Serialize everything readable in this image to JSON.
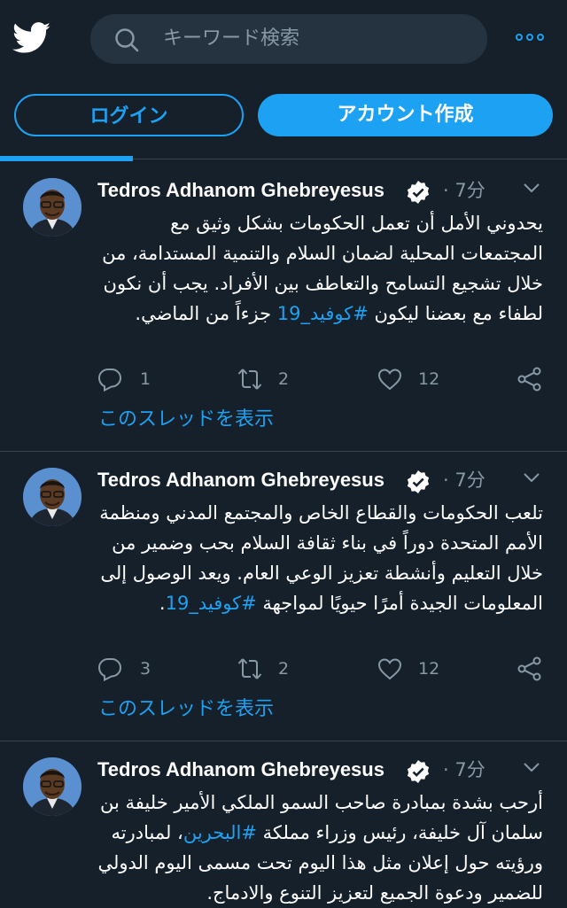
{
  "header": {
    "search_placeholder": "キーワード検索",
    "accent_color": "#1da1f2",
    "background_color": "#15202b"
  },
  "auth": {
    "login_label": "ログイン",
    "signup_label": "アカウント作成"
  },
  "tweets": [
    {
      "author": "Tedros Adhanom Ghebreyesus",
      "time": "· 7分",
      "text_before": "يحدوني الأمل أن تعمل الحكومات بشكل وثيق مع المجتمعات المحلية لضمان السلام والتنمية المستدامة، من خلال تشجيع التسامح والتعاطف بين الأفراد. يجب أن نكون لطفاء مع بعضنا ليكون ",
      "hashtag": "#كوفيد_19",
      "text_after": " جزءاً من الماضي.",
      "replies": "1",
      "retweets": "2",
      "likes": "12",
      "thread_link": "このスレッドを表示"
    },
    {
      "author": "Tedros Adhanom Ghebreyesus",
      "time": "· 7分",
      "text_before": "تلعب الحكومات والقطاع الخاص والمجتمع المدني ومنظمة الأمم المتحدة دوراً في بناء ثقافة السلام بحب وضمير  من خلال التعليم وأنشطة تعزيز الوعي العام. ويعد الوصول إلى المعلومات الجيدة أمرًا حيويًا لمواجهة ",
      "hashtag": "#كوفيد_19",
      "text_after": ".",
      "replies": "3",
      "retweets": "2",
      "likes": "12",
      "thread_link": "このスレッドを表示"
    },
    {
      "author": "Tedros Adhanom Ghebreyesus",
      "time": "· 7分",
      "text_before": "أرحب بشدة بمبادرة صاحب السمو الملكي الأمير خليفة بن سلمان آل خليفة، رئيس وزراء مملكة ",
      "hashtag": "#البحرين",
      "text_after": "، لمبادرته ورؤيته حول إعلان مثل هذا اليوم تحت مسمى اليوم الدولي للضمير ودعوة الجميع لتعزيز التنوع والادماج."
    }
  ],
  "icons": {
    "logo": "twitter-bird-icon",
    "search": "search-icon",
    "more": "more-dots-icon",
    "verified": "verified-badge-icon",
    "caret": "chevron-down-icon",
    "reply": "reply-icon",
    "retweet": "retweet-icon",
    "like": "heart-icon",
    "share": "share-icon"
  }
}
